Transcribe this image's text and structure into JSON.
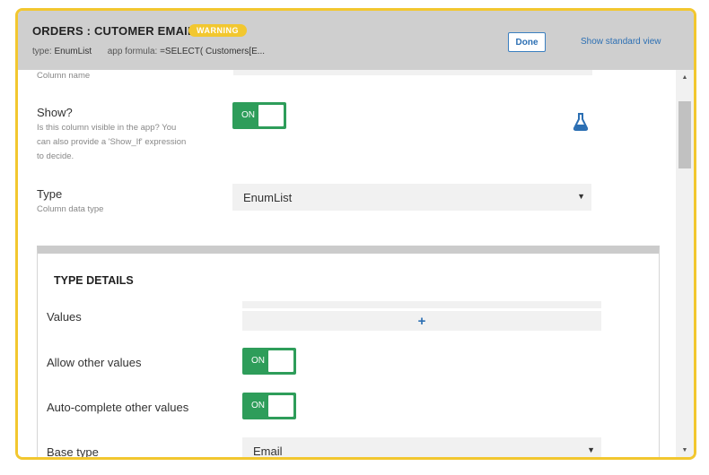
{
  "dialog": {
    "title": "ORDERS : CUTOMER EMAIL2",
    "badge": "WARNING",
    "type_label": "type:",
    "type_value": "EnumList",
    "formula_label": "app formula:",
    "formula_value": "=SELECT( Customers[E...",
    "done_label": "Done",
    "standard_view_label": "Show standard view"
  },
  "column_name": {
    "hint": "Column name"
  },
  "show": {
    "label": "Show?",
    "hint1": "Is this column visible in the app? You",
    "hint2": "can also provide a 'Show_If' expression",
    "hint3": "to decide.",
    "toggle_label": "ON",
    "icon": "flask-icon"
  },
  "type": {
    "label": "Type",
    "hint": "Column data type",
    "value": "EnumList"
  },
  "type_details": {
    "title": "TYPE DETAILS",
    "values_label": "Values",
    "add_symbol": "+",
    "allow_other_label": "Allow other values",
    "allow_other_toggle": "ON",
    "autocomplete_label": "Auto-complete other values",
    "autocomplete_toggle": "ON",
    "base_type_label": "Base type",
    "base_type_value": "Email"
  },
  "colors": {
    "accent_border": "#f2c72f",
    "toggle_on": "#2e9d5a",
    "link": "#2c6fb3"
  }
}
